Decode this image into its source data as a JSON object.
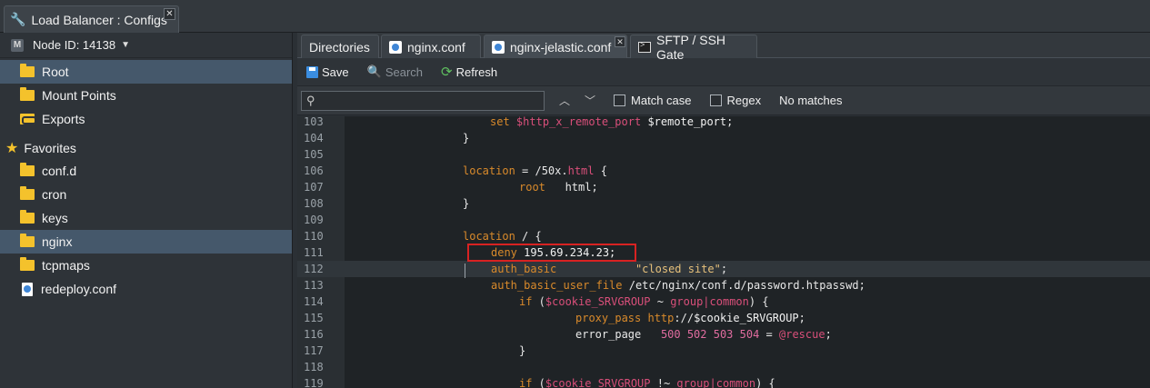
{
  "window": {
    "title": "Load Balancer : Configs",
    "close": "✕"
  },
  "sidebar": {
    "node_label": "Node ID: 14138",
    "items": [
      {
        "label": "Root",
        "icon": "folder-icon",
        "selected": true
      },
      {
        "label": "Mount Points",
        "icon": "folder-icon"
      },
      {
        "label": "Exports",
        "icon": "exports-icon"
      },
      {
        "label": "Favorites",
        "icon": "star-icon"
      },
      {
        "label": "conf.d",
        "icon": "folder-icon"
      },
      {
        "label": "cron",
        "icon": "folder-icon"
      },
      {
        "label": "keys",
        "icon": "folder-icon"
      },
      {
        "label": "nginx",
        "icon": "folder-icon",
        "selected": true
      },
      {
        "label": "tcpmaps",
        "icon": "folder-icon"
      },
      {
        "label": "redeploy.conf",
        "icon": "config-file-icon"
      }
    ]
  },
  "tabs": [
    {
      "label": "Directories"
    },
    {
      "label": "nginx.conf"
    },
    {
      "label": "nginx-jelastic.conf",
      "active": true
    },
    {
      "label": "SFTP / SSH Gate"
    }
  ],
  "toolbar": {
    "save": "Save",
    "search": "Search",
    "refresh": "Refresh"
  },
  "find": {
    "placeholder": "",
    "match_case": "Match case",
    "regex": "Regex",
    "status": "No matches"
  },
  "code": {
    "lines": [
      {
        "n": "103",
        "t": ""
      },
      {
        "n": "104",
        "t": "}"
      },
      {
        "n": "105",
        "t": ""
      },
      {
        "n": "106",
        "t": ""
      },
      {
        "n": "107",
        "t": ""
      },
      {
        "n": "108",
        "t": "}"
      },
      {
        "n": "109",
        "t": ""
      },
      {
        "n": "110",
        "t": ""
      },
      {
        "n": "111",
        "t": ""
      },
      {
        "n": "112",
        "t": ""
      },
      {
        "n": "113",
        "t": ""
      },
      {
        "n": "114",
        "t": ""
      },
      {
        "n": "115",
        "t": ""
      },
      {
        "n": "116",
        "t": ""
      },
      {
        "n": "117",
        "t": "}"
      },
      {
        "n": "118",
        "t": ""
      },
      {
        "n": "119",
        "t": ""
      }
    ],
    "l103_set": "set",
    "l103_var1": "$http_x_remote_port",
    "l103_var2": "$remote_port",
    "l103_end": ";",
    "l106_loc": "location",
    "l106_rest": " = /50x.",
    "l106_html": "html",
    "l106_brace": " {",
    "l107_root": "root",
    "l107_val": "   html;",
    "l110_loc": "location",
    "l110_rest": " / {",
    "l111_deny": "deny",
    "l111_ip": " 195.69.234.23;",
    "l112_auth": "auth_basic",
    "l112_val": "\"closed site\"",
    "l112_end": ";",
    "l113_key": "auth_basic_user_file",
    "l113_val": " /etc/nginx/conf.d/password.htpasswd;",
    "l114_if": "if",
    "l114_a": " (",
    "l114_var": "$cookie_SRVGROUP",
    "l114_op": " ~ ",
    "l114_g": "group|common",
    "l114_end": ") {",
    "l115_pp": "proxy_pass",
    "l115_proto": " http",
    "l115_rest": "://",
    "l115_var": "$cookie_SRVGROUP",
    "l115_end": ";",
    "l116_ep": "error_page",
    "l116_codes": "500 502 503 504",
    "l116_eq": " = ",
    "l116_res": "@rescue",
    "l116_end": ";",
    "l119_if": "if",
    "l119_a": " (",
    "l119_var": "$cookie_SRVGROUP",
    "l119_op": " !~ ",
    "l119_g": "group|common",
    "l119_end": ") {"
  }
}
